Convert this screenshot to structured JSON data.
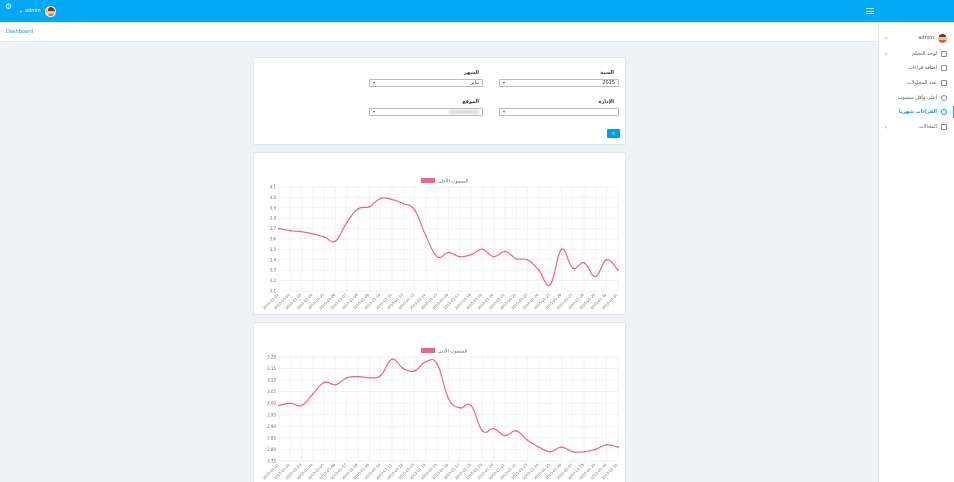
{
  "topbar": {
    "username": "admin",
    "caret": "▾",
    "gear_icon": "gear-icon",
    "menu_icon": "hamburger-icon"
  },
  "breadcrumb": {
    "label": "Dashboard"
  },
  "sidebar": {
    "user": "admin",
    "items": [
      {
        "label": "لوحة التحكم",
        "icon": "dashboard-icon",
        "chevron": true
      },
      {
        "label": "اضافة قراءات",
        "icon": "form-icon",
        "chevron": false
      },
      {
        "label": "عدد المحاولات",
        "icon": "form-icon",
        "chevron": false
      },
      {
        "label": "أعلى وأقل منسوب",
        "icon": "chart-icon",
        "chevron": false
      },
      {
        "label": "القراءات شهريا",
        "icon": "chart-icon",
        "chevron": false,
        "active": true
      },
      {
        "label": "المحالات",
        "icon": "monitor-icon",
        "chevron": true
      }
    ]
  },
  "filters": {
    "year": {
      "label": "السنة",
      "value": "2015"
    },
    "month": {
      "label": "الشهر",
      "value": "يناير"
    },
    "admin": {
      "label": "الإدارة",
      "value": ""
    },
    "site": {
      "label": "الموقع",
      "value": ""
    },
    "search_icon": "search-icon"
  },
  "chart_data": [
    {
      "type": "line",
      "series": [
        {
          "name": "المنسوب الأعلى",
          "color": "#f06292"
        }
      ],
      "ylim": [
        3.1,
        4.1
      ],
      "yticks": [
        "4.1",
        "4.0",
        "3.9",
        "3.8",
        "3.7",
        "3.6",
        "3.5",
        "3.4",
        "3.3",
        "3.2",
        "3.1"
      ],
      "x": [
        "2015-01-01",
        "2015-01-02",
        "2015-01-03",
        "2015-01-04",
        "2015-01-05",
        "2015-01-06",
        "2015-01-07",
        "2015-01-08",
        "2015-01-09",
        "2015-01-10",
        "2015-01-11",
        "2015-01-12",
        "2015-01-13",
        "2015-01-14",
        "2015-01-15",
        "2015-01-16",
        "2015-01-17",
        "2015-01-18",
        "2015-01-19",
        "2015-01-20",
        "2015-01-21",
        "2015-01-22",
        "2015-01-23",
        "2015-01-24",
        "2015-01-25",
        "2015-01-26",
        "2015-01-27",
        "2015-01-28",
        "2015-01-29",
        "2015-01-30",
        "2015-01-31"
      ],
      "values": [
        3.7,
        3.68,
        3.67,
        3.65,
        3.62,
        3.58,
        3.76,
        3.89,
        3.91,
        3.99,
        3.98,
        3.94,
        3.88,
        3.63,
        3.43,
        3.47,
        3.43,
        3.45,
        3.5,
        3.43,
        3.48,
        3.41,
        3.4,
        3.3,
        3.16,
        3.5,
        3.32,
        3.37,
        3.24,
        3.4,
        3.3
      ]
    },
    {
      "type": "line",
      "series": [
        {
          "name": "المنسوب الأدنى",
          "color": "#f06292"
        }
      ],
      "ylim": [
        2.75,
        3.2
      ],
      "yticks": [
        "3.20",
        "3.15",
        "3.10",
        "3.05",
        "3.00",
        "2.95",
        "2.90",
        "2.85",
        "2.80",
        "2.75"
      ],
      "x": [
        "2015-01-01",
        "2015-01-02",
        "2015-01-03",
        "2015-01-04",
        "2015-01-05",
        "2015-01-06",
        "2015-01-07",
        "2015-01-08",
        "2015-01-09",
        "2015-01-10",
        "2015-01-11",
        "2015-01-12",
        "2015-01-13",
        "2015-01-14",
        "2015-01-15",
        "2015-01-16",
        "2015-01-17",
        "2015-01-18",
        "2015-01-19",
        "2015-01-20",
        "2015-01-21",
        "2015-01-22",
        "2015-01-23",
        "2015-01-24",
        "2015-01-25",
        "2015-01-26",
        "2015-01-27",
        "2015-01-28",
        "2015-01-29",
        "2015-01-30",
        "2015-01-31"
      ],
      "values": [
        2.99,
        3.0,
        2.99,
        3.04,
        3.09,
        3.08,
        3.11,
        3.115,
        3.11,
        3.12,
        3.19,
        3.15,
        3.14,
        3.18,
        3.17,
        3.02,
        2.98,
        2.99,
        2.88,
        2.89,
        2.86,
        2.88,
        2.84,
        2.81,
        2.79,
        2.81,
        2.79,
        2.79,
        2.8,
        2.82,
        2.81
      ]
    }
  ]
}
